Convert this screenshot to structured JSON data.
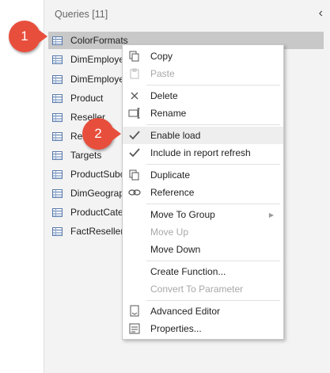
{
  "panel": {
    "title": "Queries [11]",
    "collapse_glyph": "‹",
    "queries": [
      {
        "label": "ColorFormats",
        "selected": true
      },
      {
        "label": "DimEmploye"
      },
      {
        "label": "DimEmploye"
      },
      {
        "label": "Product"
      },
      {
        "label": "Reseller"
      },
      {
        "label": "Re"
      },
      {
        "label": "Targets"
      },
      {
        "label": "ProductSubc"
      },
      {
        "label": "DimGeograp"
      },
      {
        "label": "ProductCate"
      },
      {
        "label": "FactResellerS"
      }
    ]
  },
  "context_menu": {
    "items": [
      {
        "label": "Copy",
        "icon": "copy-icon",
        "enabled": true
      },
      {
        "label": "Paste",
        "icon": "paste-icon",
        "enabled": false
      },
      {
        "label": "Delete",
        "icon": "delete-icon",
        "enabled": true
      },
      {
        "label": "Rename",
        "icon": "rename-icon",
        "enabled": true
      },
      {
        "label": "Enable load",
        "icon": "checkmark-icon",
        "enabled": true,
        "checked": true
      },
      {
        "label": "Include in report refresh",
        "icon": "checkmark-icon",
        "enabled": true,
        "checked": true
      },
      {
        "label": "Duplicate",
        "icon": "duplicate-icon",
        "enabled": true
      },
      {
        "label": "Reference",
        "icon": "reference-icon",
        "enabled": true
      },
      {
        "label": "Move To Group",
        "icon": "",
        "enabled": true,
        "submenu": true
      },
      {
        "label": "Move Up",
        "icon": "",
        "enabled": false
      },
      {
        "label": "Move Down",
        "icon": "",
        "enabled": true
      },
      {
        "label": "Create Function...",
        "icon": "",
        "enabled": true
      },
      {
        "label": "Convert To Parameter",
        "icon": "",
        "enabled": false
      },
      {
        "label": "Advanced Editor",
        "icon": "advanced-editor-icon",
        "enabled": true
      },
      {
        "label": "Properties...",
        "icon": "properties-icon",
        "enabled": true
      }
    ]
  },
  "callouts": [
    {
      "label": "1"
    },
    {
      "label": "2"
    }
  ],
  "colors": {
    "callout": "#e84e3c",
    "selected_row": "#c8c8c8",
    "panel_bg": "#f3f3f3"
  }
}
